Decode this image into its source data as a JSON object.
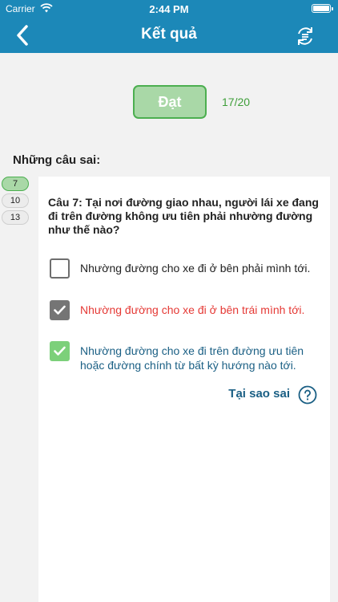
{
  "status_bar": {
    "carrier": "Carrier",
    "time": "2:44 PM"
  },
  "header": {
    "title": "Kết quả",
    "bg_color": "#1c88b8"
  },
  "result": {
    "status": "Đạt",
    "score": "17/20",
    "badge_color": "#a9d8a7",
    "score_color": "#3f9f3a"
  },
  "wrong_section": {
    "heading": "Những câu sai:",
    "question_numbers": [
      "7",
      "10",
      "13"
    ],
    "active_index": 0
  },
  "question": {
    "text": "Câu 7: Tại nơi đường giao nhau, người lái xe đang đi trên đường không ưu tiên phải nhường đường như thế nào?",
    "answers": [
      {
        "text": "Nhường đường cho xe đi ở bên phải mình tới.",
        "state": "empty",
        "color": "#222222"
      },
      {
        "text": "Nhường đường cho xe đi ở bên trái mình tới.",
        "state": "selected-wrong",
        "color": "#e53935"
      },
      {
        "text": "Nhường đường cho xe đi trên đường ưu tiên hoặc đường chính từ bất kỳ hướng nào tới.",
        "state": "correct",
        "color": "#1a5f84"
      }
    ],
    "why_wrong_label": "Tại sao sai",
    "help_icon": "question-circle-icon"
  }
}
